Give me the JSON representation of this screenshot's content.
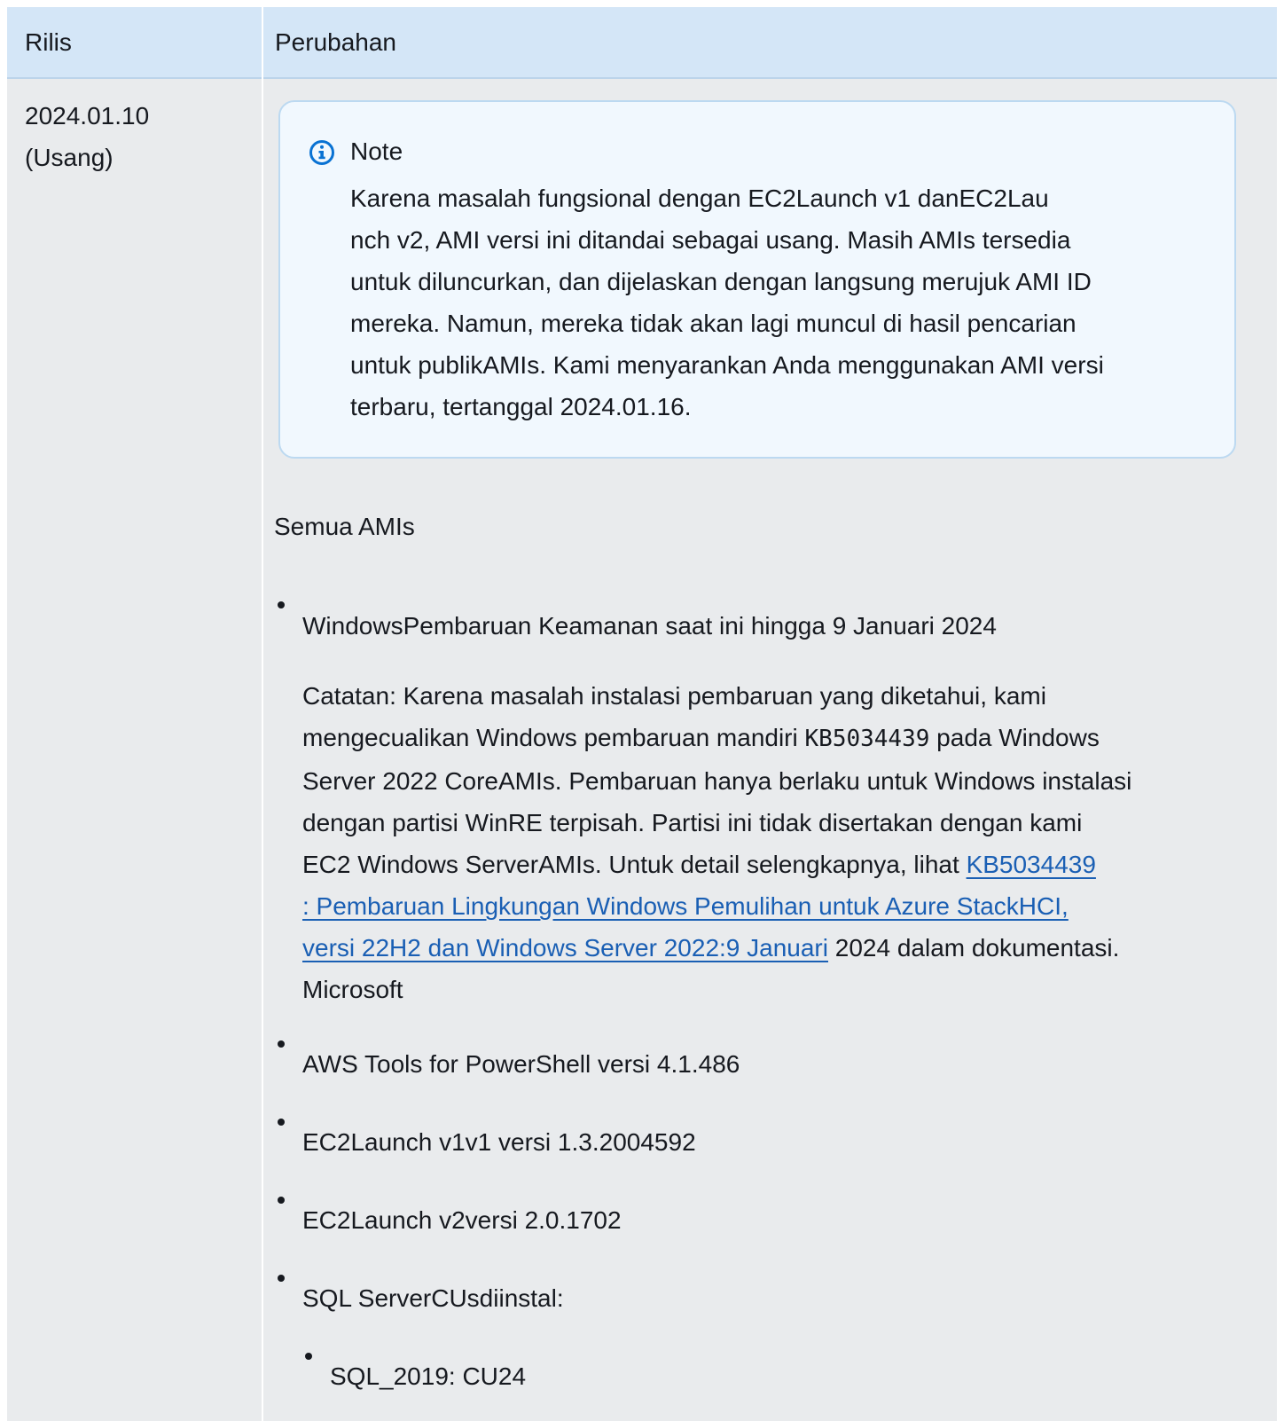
{
  "table": {
    "header": {
      "col_release": "Rilis",
      "col_changes": "Perubahan"
    },
    "row": {
      "release_version": "2024.01.10",
      "release_status": "(Usang)",
      "note": {
        "icon": "info-icon",
        "title": "Note",
        "lines": [
          "Karena masalah fungsional dengan EC2Launch v1 danEC2Lau",
          "nch v2, AMI versi ini ditandai sebagai usang. Masih AMIs tersedia",
          "untuk diluncurkan, dan dijelaskan dengan langsung merujuk AMI ID",
          "mereka. Namun, mereka tidak akan lagi muncul di hasil pencarian",
          "untuk publikAMIs. Kami menyarankan Anda menggunakan AMI versi",
          "terbaru, tertanggal 2024.01.16."
        ]
      },
      "section_title": "Semua AMIs",
      "items": {
        "security_update": "WindowsPembaruan Keamanan saat ini hingga 9 Januari 2024",
        "catatan_l1": "Catatan: Karena masalah instalasi pembaruan yang diketahui, kami",
        "catatan_l2_a": "mengecualikan Windows pembaruan mandiri ",
        "catatan_l2_code": "KB5034439",
        "catatan_l2_b": " pada Windows",
        "catatan_l3": "Server 2022 CoreAMIs. Pembaruan hanya berlaku untuk Windows instalasi",
        "catatan_l4": "dengan partisi WinRE terpisah. Partisi ini tidak disertakan dengan kami",
        "catatan_l5_a": "EC2 Windows ServerAMIs. Untuk detail selengkapnya, lihat ",
        "catatan_link_l1": "KB5034439",
        "catatan_link_l2": ": Pembaruan Lingkungan Windows Pemulihan untuk Azure StackHCI,",
        "catatan_link_l3": "versi 22H2 dan Windows Server 2022:9 Januari",
        "catatan_l7_b": " 2024 dalam dokumentasi.",
        "catatan_l8": "Microsoft",
        "tools": "AWS Tools for PowerShell versi 4.1.486",
        "ec2launch_v1": "EC2Launch v1v1 versi 1.3.2004592",
        "ec2launch_v2": "EC2Launch v2versi 2.0.1702",
        "sql_cus": "SQL ServerCUsdiinstal:",
        "sql_2019": "SQL_2019: CU24"
      }
    }
  },
  "colors": {
    "header_bg": "#d4e6f7",
    "row_bg": "#e9ebed",
    "note_bg": "#f1f8fe",
    "note_border": "#bcd9f1",
    "info_icon": "#0972d3",
    "link": "#1a5fb4"
  }
}
